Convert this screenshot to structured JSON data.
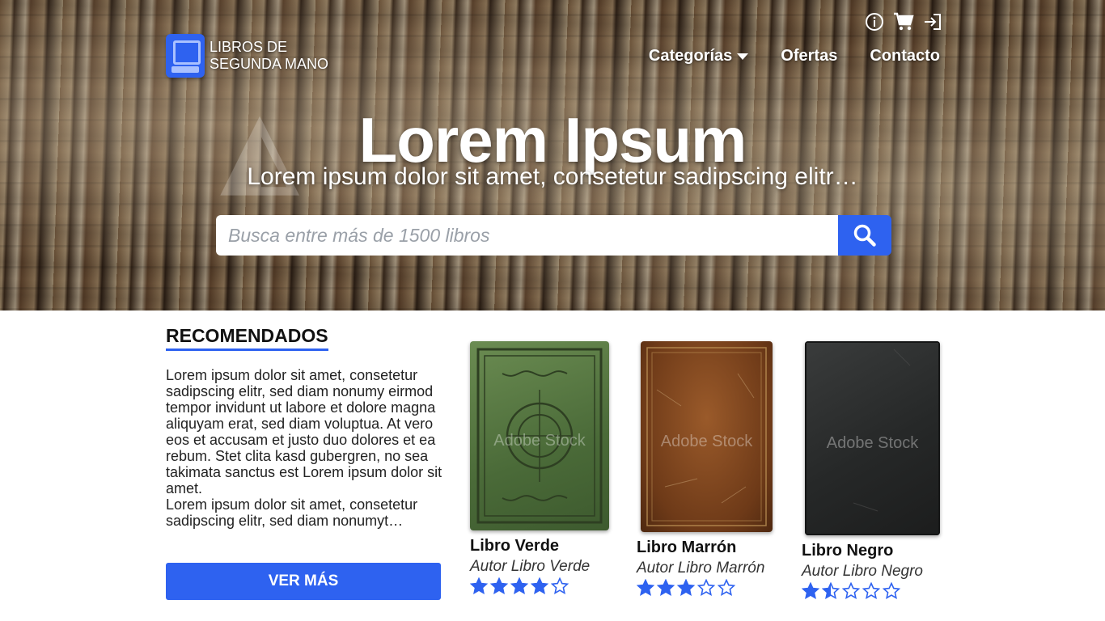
{
  "brand": {
    "name_line1": "LIBROS DE",
    "name_line2": "SEGUNDA MANO"
  },
  "top_icons": [
    "info-icon",
    "cart-icon",
    "login-icon"
  ],
  "nav": {
    "items": [
      "Categorías",
      "Ofertas",
      "Contacto"
    ]
  },
  "hero": {
    "title": "Lorem Ipsum",
    "subtitle": "Lorem ipsum dolor sit amet, consetetur sadipscing elitr…",
    "search_placeholder": "Busca entre más de 1500 libros",
    "watermark": "Adobe Stock"
  },
  "recommended": {
    "heading": "RECOMENDADOS",
    "paragraph1": "Lorem ipsum dolor sit amet, consetetur sadipscing elitr, sed diam nonumy eirmod tempor invidunt ut labore et dolore magna aliquyam erat, sed diam voluptua. At vero eos et accusam et justo duo dolores et ea rebum. Stet clita kasd gubergren, no sea takimata sanctus est Lorem ipsum dolor sit amet.",
    "paragraph2": "Lorem ipsum dolor sit amet, consetetur sadipscing elitr, sed diam nonumyt…",
    "button": "VER MÁS"
  },
  "books": [
    {
      "title": "Libro Verde",
      "author": "Autor Libro Verde",
      "rating": 4,
      "watermark": "Adobe Stock",
      "cover_color": "#5a7a44"
    },
    {
      "title": "Libro Marrón",
      "author": "Autor Libro Marrón",
      "rating": 3,
      "watermark": "Adobe Stock",
      "cover_color": "#7a4520"
    },
    {
      "title": "Libro Negro",
      "author": "Autor Libro Negro",
      "rating": 1.5,
      "watermark": "Adobe Stock",
      "cover_color": "#2c2e2e"
    }
  ],
  "colors": {
    "accent": "#2e62f0",
    "star": "#2e62f0"
  }
}
